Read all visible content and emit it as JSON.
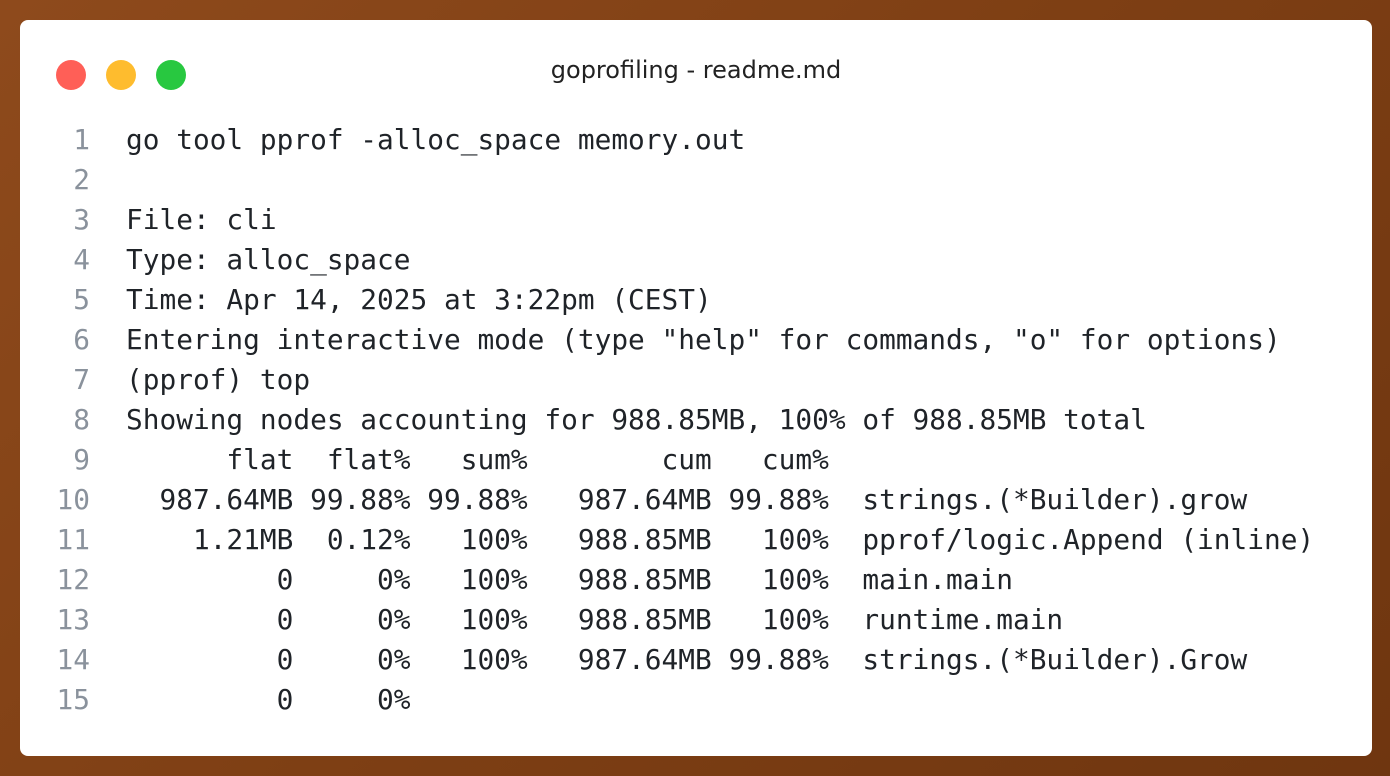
{
  "window": {
    "title": "goprofiling - readme.md"
  },
  "lines": [
    "go tool pprof -alloc_space memory.out",
    "",
    "File: cli",
    "Type: alloc_space",
    "Time: Apr 14, 2025 at 3:22pm (CEST)",
    "Entering interactive mode (type \"help\" for commands, \"o\" for options)",
    "(pprof) top",
    "Showing nodes accounting for 988.85MB, 100% of 988.85MB total",
    "      flat  flat%   sum%        cum   cum%",
    "  987.64MB 99.88% 99.88%   987.64MB 99.88%  strings.(*Builder).grow",
    "    1.21MB  0.12%   100%   988.85MB   100%  pprof/logic.Append (inline)",
    "         0     0%   100%   988.85MB   100%  main.main",
    "         0     0%   100%   988.85MB   100%  runtime.main",
    "         0     0%   100%   987.64MB 99.88%  strings.(*Builder).Grow",
    "         0     0%"
  ],
  "line_numbers": [
    "1",
    "2",
    "3",
    "4",
    "5",
    "6",
    "7",
    "8",
    "9",
    "10",
    "11",
    "12",
    "13",
    "14",
    "15"
  ]
}
